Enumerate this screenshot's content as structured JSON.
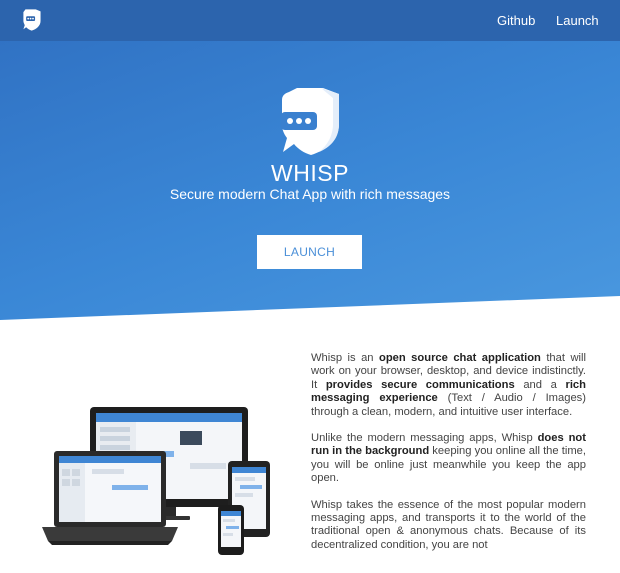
{
  "nav": {
    "github": "Github",
    "launch": "Launch"
  },
  "hero": {
    "title": "WHISP",
    "subtitle": "Secure modern Chat App with rich messages",
    "launch_button": "LAUNCH"
  },
  "description": {
    "p1": [
      {
        "t": "Whisp is an ",
        "b": false
      },
      {
        "t": "open source chat application",
        "b": true
      },
      {
        "t": " that will work on your browser, desktop, and device indistinctly. It ",
        "b": false
      },
      {
        "t": "provides secure communications",
        "b": true
      },
      {
        "t": " and a ",
        "b": false
      },
      {
        "t": "rich messaging experience",
        "b": true
      },
      {
        "t": " (Text / Audio / Images) through a clean, modern, and intuitive user interface.",
        "b": false
      }
    ],
    "p2": [
      {
        "t": "Unlike the modern messaging apps, Whisp ",
        "b": false
      },
      {
        "t": "does not run in the background",
        "b": true
      },
      {
        "t": " keeping you online all the time, you will be online just meanwhile you keep the app open.",
        "b": false
      }
    ],
    "p3": [
      {
        "t": "Whisp takes the essence of the most popular modern messaging apps, and transports it to the world of the traditional open & anonymous chats. Because of its decentralized condition, you are not",
        "b": false
      }
    ]
  },
  "colors": {
    "nav_bg": "#2c64ad",
    "hero_start": "#2f6fc1",
    "hero_end": "#4a98df",
    "accent": "#4a8fd8"
  },
  "icons": [
    "whisp-shield-logo-icon",
    "devices-illustration"
  ]
}
